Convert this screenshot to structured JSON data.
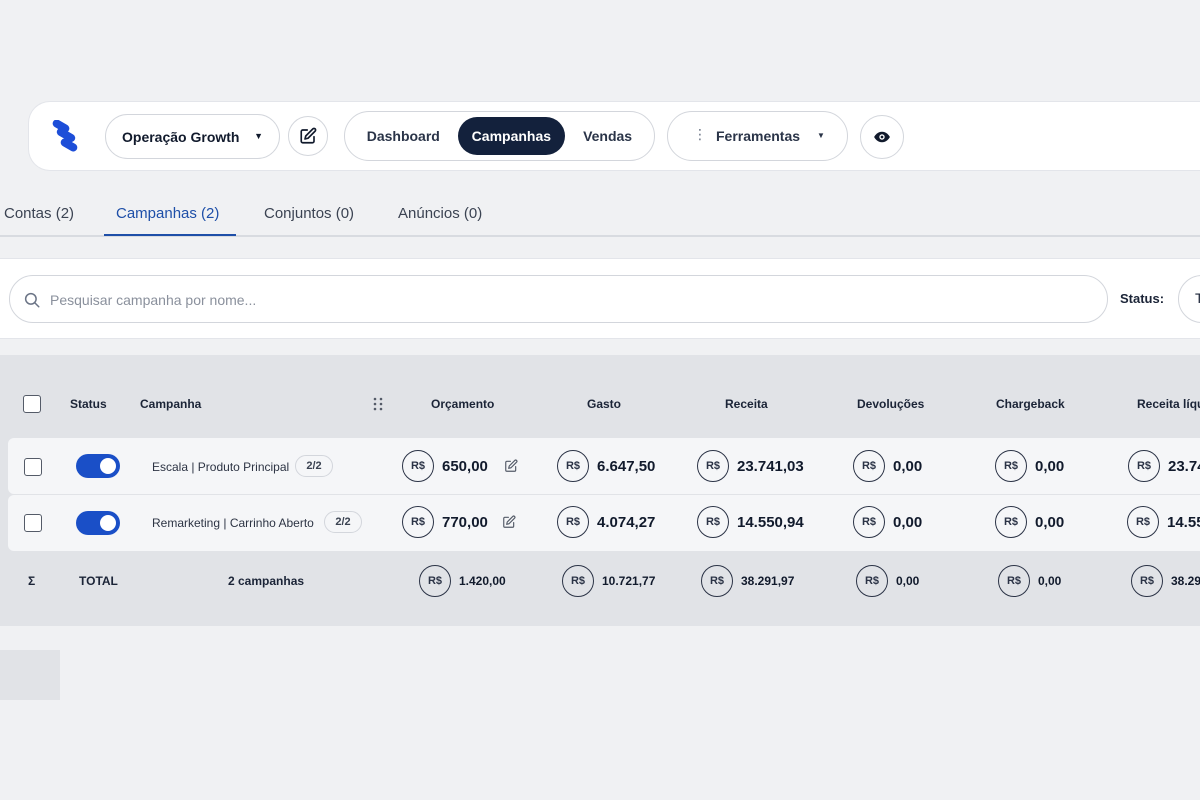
{
  "header": {
    "operation_label": "Operação Growth",
    "nav": {
      "dashboard": "Dashboard",
      "campanhas": "Campanhas",
      "vendas": "Vendas"
    },
    "tools_label": "Ferramentas"
  },
  "tabs": [
    {
      "label": "Contas (2)"
    },
    {
      "label": "Campanhas (2)"
    },
    {
      "label": "Conjuntos (0)"
    },
    {
      "label": "Anúncios (0)"
    }
  ],
  "search": {
    "placeholder": "Pesquisar campanha por nome...",
    "status_label": "Status:",
    "status_value": "T"
  },
  "table": {
    "columns": {
      "status": "Status",
      "campanha": "Campanha",
      "orcamento": "Orçamento",
      "gasto": "Gasto",
      "receita": "Receita",
      "devolucoes": "Devoluções",
      "chargeback": "Chargeback",
      "receita_liquida": "Receita líqu"
    },
    "currency": "R$",
    "rows": [
      {
        "name": "Escala | Produto Principal",
        "badge": "2/2",
        "active": true,
        "orcamento": "650,00",
        "gasto": "6.647,50",
        "receita": "23.741,03",
        "devolucoes": "0,00",
        "chargeback": "0,00",
        "receita_liquida": "23.74"
      },
      {
        "name": "Remarketing | Carrinho Aberto",
        "badge": "2/2",
        "active": true,
        "orcamento": "770,00",
        "gasto": "4.074,27",
        "receita": "14.550,94",
        "devolucoes": "0,00",
        "chargeback": "0,00",
        "receita_liquida": "14.55"
      }
    ],
    "total": {
      "sigma": "Σ",
      "label": "TOTAL",
      "count": "2 campanhas",
      "orcamento": "1.420,00",
      "gasto": "10.721,77",
      "receita": "38.291,97",
      "devolucoes": "0,00",
      "chargeback": "0,00",
      "receita_liquida": "38.29"
    }
  },
  "colors": {
    "accent": "#1a4fc7",
    "nav_active": "#13213c",
    "tab_active": "#1e4fa8"
  }
}
